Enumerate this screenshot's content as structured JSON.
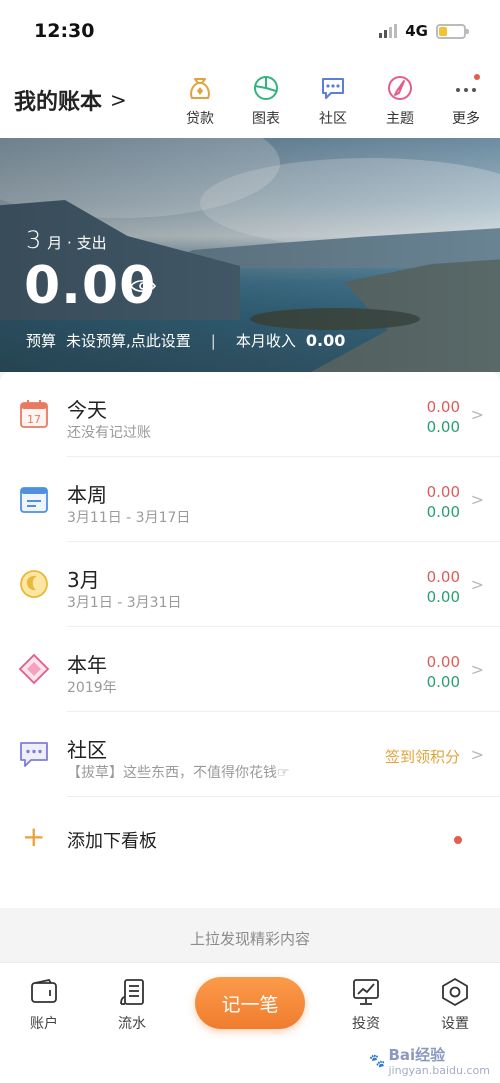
{
  "status_bar": {
    "time": "12:30",
    "network": "4G"
  },
  "header": {
    "book_title": "我的账本",
    "tools": [
      {
        "label": "贷款",
        "icon": "money-bag-icon"
      },
      {
        "label": "图表",
        "icon": "pie-chart-icon"
      },
      {
        "label": "社区",
        "icon": "chat-bubble-icon"
      },
      {
        "label": "主题",
        "icon": "theme-brush-icon"
      },
      {
        "label": "更多",
        "icon": "more-dots-icon"
      }
    ]
  },
  "banner": {
    "month": "3",
    "month_suffix": "月 · 支出",
    "amount": "0.00",
    "budget_label": "预算",
    "budget_value": "未设预算,点此设置",
    "income_label": "本月收入",
    "income_value": "0.00"
  },
  "rows": [
    {
      "title": "今天",
      "sub": "还没有记过账",
      "out": "0.00",
      "in": "0.00",
      "icon": "calendar-17-icon"
    },
    {
      "title": "本周",
      "sub": "3月11日 - 3月17日",
      "out": "0.00",
      "in": "0.00",
      "icon": "calendar-week-icon"
    },
    {
      "title": "3月",
      "sub": "3月1日 - 3月31日",
      "out": "0.00",
      "in": "0.00",
      "icon": "moon-icon"
    },
    {
      "title": "本年",
      "sub": "2019年",
      "out": "0.00",
      "in": "0.00",
      "icon": "diamond-icon"
    }
  ],
  "community": {
    "title": "社区",
    "sub": "【拔草】这些东西，不值得你花钱☞",
    "action": "签到领积分"
  },
  "add_board": {
    "label": "添加下看板"
  },
  "pull_hint": "上拉发现精彩内容",
  "tabbar": {
    "account": "账户",
    "flow": "流水",
    "record": "记一笔",
    "invest": "投资",
    "settings": "设置"
  },
  "watermark": {
    "main": "Bai经验",
    "sub": "jingyan.baidu.com"
  },
  "colors": {
    "accent": "#f07c2e",
    "expense": "#e15a5a",
    "income": "#27a06f"
  }
}
